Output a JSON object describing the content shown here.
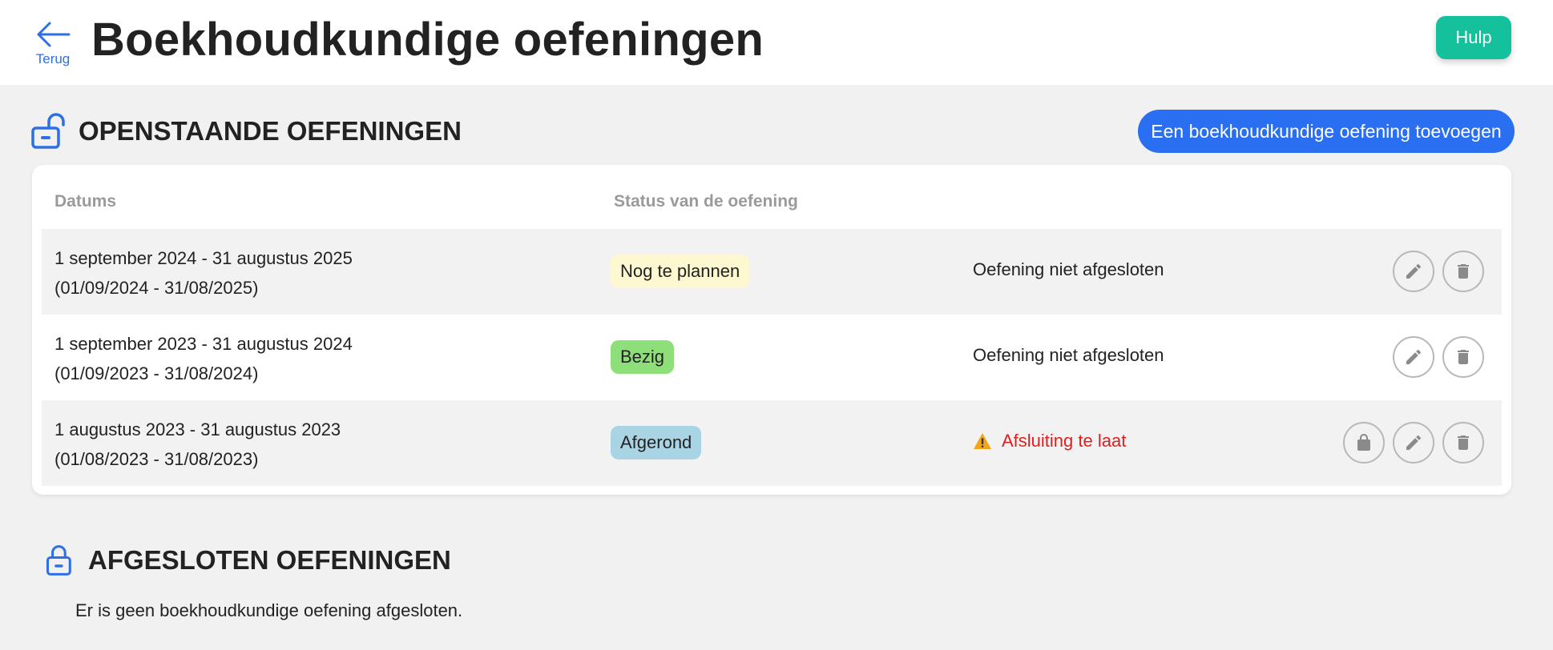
{
  "header": {
    "back_label": "Terug",
    "title": "Boekhoudkundige oefeningen",
    "help_label": "Hulp"
  },
  "open_section": {
    "title": "OPENSTAANDE OEFENINGEN",
    "add_button": "Een boekhoudkundige oefening toevoegen",
    "columns": [
      "Datums",
      "Status van de oefening"
    ],
    "rows": [
      {
        "date_line1": "1 september 2024 - 31 augustus 2025",
        "date_line2": "(01/09/2024 - 31/08/2025)",
        "status": "Nog te plannen",
        "closing": "Oefening niet afgesloten"
      },
      {
        "date_line1": "1 september 2023 - 31 augustus 2024",
        "date_line2": "(01/09/2023 - 31/08/2024)",
        "status": "Bezig",
        "closing": "Oefening niet afgesloten"
      },
      {
        "date_line1": "1 augustus 2023 - 31 augustus 2023",
        "date_line2": "(01/08/2023 - 31/08/2023)",
        "status": "Afgerond",
        "closing": "Afsluiting te laat"
      }
    ]
  },
  "closed_section": {
    "title": "AFGESLOTEN OEFENINGEN",
    "empty_text": "Er is geen boekhoudkundige oefening afgesloten."
  },
  "colors": {
    "accent": "#2a6ef2",
    "help": "#14c19c",
    "status_to_plan": "#fdf8d0",
    "status_busy": "#8ede7a",
    "status_done": "#a9d4e3",
    "late": "#e02020"
  },
  "icons": {
    "back": "arrow-left-icon",
    "open_section": "lock-open-icon",
    "closed_section": "lock-closed-icon",
    "edit": "pencil-icon",
    "delete": "trash-icon",
    "lock": "lock-icon",
    "warning": "warning-icon"
  }
}
